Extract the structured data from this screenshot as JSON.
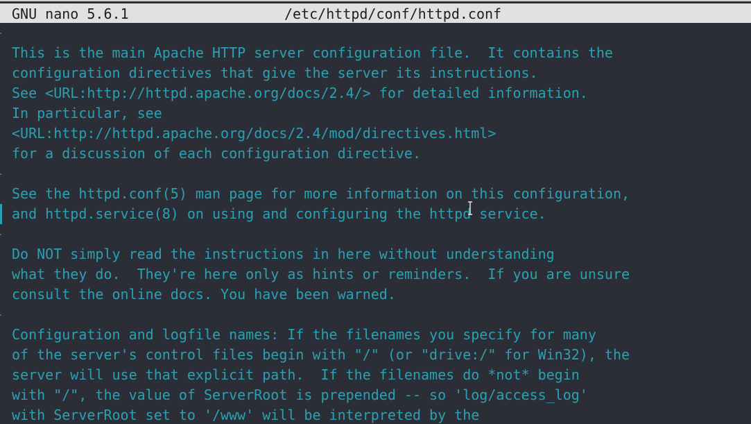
{
  "titlebar": {
    "app": "GNU nano 5.6.1",
    "file": "/etc/httpd/conf/httpd.conf"
  },
  "cursor_icon": "text-ibeam-cursor",
  "lines": [
    "",
    "This is the main Apache HTTP server configuration file.  It contains the",
    "configuration directives that give the server its instructions.",
    "See <URL:http://httpd.apache.org/docs/2.4/> for detailed information.",
    "In particular, see",
    "<URL:http://httpd.apache.org/docs/2.4/mod/directives.html>",
    "for a discussion of each configuration directive.",
    "",
    "See the httpd.conf(5) man page for more information on this configuration,",
    "and httpd.service(8) on using and configuring the httpd service.",
    "",
    "Do NOT simply read the instructions in here without understanding",
    "what they do.  They're here only as hints or reminders.  If you are unsure",
    "consult the online docs. You have been warned.",
    "",
    "Configuration and logfile names: If the filenames you specify for many",
    "of the server's control files begin with \"/\" (or \"drive:/\" for Win32), the",
    "server will use that explicit path.  If the filenames do *not* begin",
    "with \"/\", the value of ServerRoot is prepended -- so 'log/access_log'",
    "with ServerRoot set to '/www' will be interpreted by the"
  ]
}
